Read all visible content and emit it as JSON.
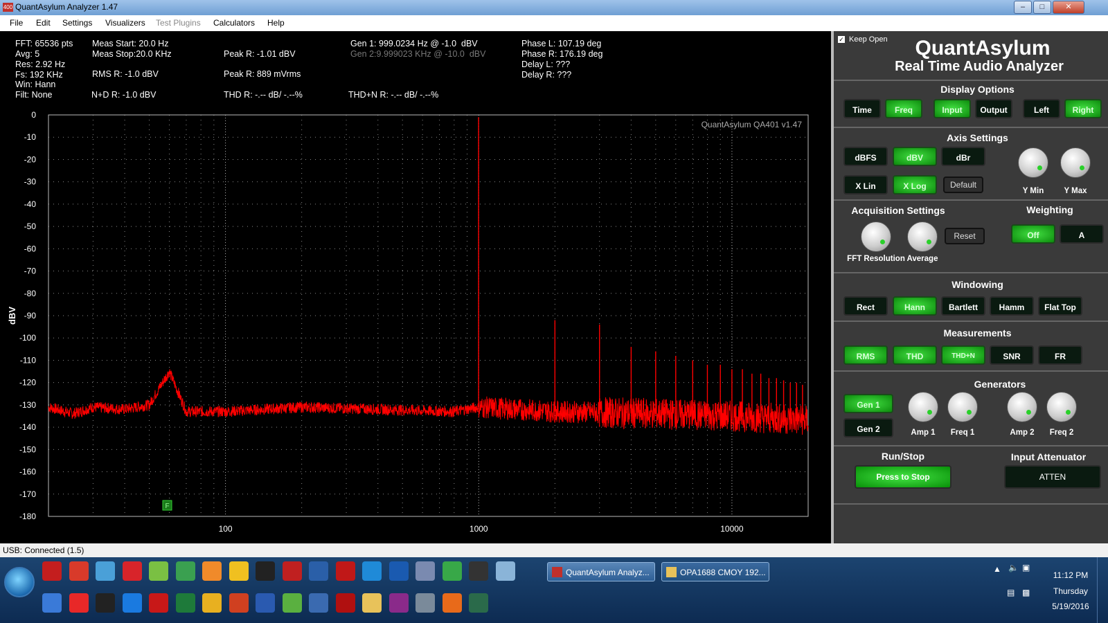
{
  "window": {
    "title": "QuantAsylum Analyzer 1.47",
    "icon_text": "400"
  },
  "menu": [
    {
      "label": "File",
      "enabled": true
    },
    {
      "label": "Edit",
      "enabled": true
    },
    {
      "label": "Settings",
      "enabled": true
    },
    {
      "label": "Visualizers",
      "enabled": true
    },
    {
      "label": "Test Plugins",
      "enabled": false
    },
    {
      "label": "Calculators",
      "enabled": true
    },
    {
      "label": "Help",
      "enabled": true
    }
  ],
  "readouts": {
    "fft": "FFT: 65536 pts",
    "avg": "Avg: 5",
    "res": "Res: 2.92 Hz",
    "fs": "Fs: 192 KHz",
    "win": "Win: Hann",
    "filt": "Filt: None",
    "meas_start": "Meas Start: 20.0 Hz",
    "meas_stop": "Meas Stop:20.0 KHz",
    "rms_r": "RMS R: -1.0 dBV",
    "nd_r": "N+D R: -1.0 dBV",
    "peak_r_dbv": "Peak R: -1.01 dBV",
    "peak_r_mv": "Peak R: 889 mVrms",
    "thd_r": "THD R: -.-- dB/ -.--%",
    "gen1": "Gen 1: 999.0234 Hz @ -1.0  dBV",
    "gen2": "Gen 2:9.999023 KHz @ -10.0  dBV",
    "thdn_r": "THD+N R: -.-- dB/ -.--%",
    "phase_l": "Phase L: 107.19 deg",
    "phase_r": "Phase R: 176.19 deg",
    "delay_l": "Delay L: ???",
    "delay_r": "Delay R: ???"
  },
  "plot": {
    "watermark": "QuantAsylum QA401 v1.47",
    "marker_label": "F",
    "trace_color": "#ff0000",
    "grid_color": "#8a8a8a"
  },
  "chart_data": {
    "type": "line",
    "title": "",
    "xlabel": "",
    "ylabel": "dBV",
    "x_scale": "log",
    "xlim": [
      20,
      20000
    ],
    "ylim": [
      -180,
      0
    ],
    "x_ticks": [
      "100",
      "1000",
      "10000"
    ],
    "y_ticks": [
      "0",
      "-10",
      "-20",
      "-30",
      "-40",
      "-50",
      "-60",
      "-70",
      "-80",
      "-90",
      "-100",
      "-110",
      "-120",
      "-130",
      "-140",
      "-150",
      "-160",
      "-170",
      "-180"
    ],
    "grid": true,
    "series": [
      {
        "color": "#ff0000",
        "baseline": [
          [
            20,
            -131
          ],
          [
            25,
            -134
          ],
          [
            30,
            -131
          ],
          [
            40,
            -132
          ],
          [
            50,
            -130
          ],
          [
            60,
            -115
          ],
          [
            70,
            -133
          ],
          [
            100,
            -133
          ],
          [
            200,
            -131
          ],
          [
            400,
            -132
          ],
          [
            800,
            -133
          ],
          [
            1000,
            -131
          ],
          [
            2000,
            -133
          ],
          [
            5000,
            -134
          ],
          [
            10000,
            -135
          ],
          [
            20000,
            -137
          ]
        ],
        "peaks": [
          [
            999,
            -1
          ],
          [
            2000,
            -92
          ],
          [
            3000,
            -94
          ],
          [
            4000,
            -104
          ],
          [
            5000,
            -106
          ],
          [
            6000,
            -108
          ],
          [
            7000,
            -110
          ],
          [
            8000,
            -112
          ],
          [
            9000,
            -112
          ],
          [
            10000,
            -114
          ],
          [
            11000,
            -114
          ],
          [
            12000,
            -116
          ],
          [
            13000,
            -116
          ],
          [
            14000,
            -118
          ],
          [
            15000,
            -118
          ],
          [
            16000,
            -119
          ],
          [
            17000,
            -120
          ],
          [
            18000,
            -120
          ],
          [
            19000,
            -121
          ]
        ]
      }
    ]
  },
  "panel": {
    "keep_open": "Keep Open",
    "brand": "QuantAsylum",
    "subtitle": "Real Time Audio Analyzer",
    "display_title": "Display Options",
    "display_buttons": [
      "Time",
      "Freq",
      "Input",
      "Output",
      "Left",
      "Right"
    ],
    "axis_title": "Axis Settings",
    "axis_buttons": [
      "dBFS",
      "dBV",
      "dBr",
      "X Lin",
      "X Log",
      "Default"
    ],
    "knob_ymin": "Y Min",
    "knob_ymax": "Y Max",
    "acq_title": "Acquisition Settings",
    "knob_fft": "FFT Resolution",
    "knob_avg": "Average",
    "reset": "Reset",
    "weight_title": "Weighting",
    "weight_buttons": [
      "Off",
      "A"
    ],
    "window_title": "Windowing",
    "window_buttons": [
      "Rect",
      "Hann",
      "Bartlett",
      "Hamm",
      "Flat Top"
    ],
    "meas_title": "Measurements",
    "meas_buttons": [
      "RMS",
      "THD",
      "THD+N",
      "SNR",
      "FR"
    ],
    "gen_title": "Generators",
    "gen_buttons": [
      "Gen 1",
      "Gen 2"
    ],
    "knob_amp1": "Amp 1",
    "knob_freq1": "Freq 1",
    "knob_amp2": "Amp 2",
    "knob_freq2": "Freq 2",
    "run_title": "Run/Stop",
    "run_button": "Press to Stop",
    "atten_title": "Input Attenuator",
    "atten_button": "ATTEN"
  },
  "status": {
    "text": "USB: Connected  (1.5)"
  },
  "taskbar": {
    "tasks": [
      "QuantAsylum Analyz...",
      "OPA1688 CMOY 192..."
    ],
    "time": "11:12 PM",
    "day": "Thursday",
    "date": "5/19/2016",
    "icons": [
      "acrobat-icon",
      "pdf-icon",
      "network-icon",
      "64-icon",
      "tool-icon",
      "app-icon",
      "pencil-icon",
      "duck-icon",
      "cmd-icon",
      "app-icon",
      "outlook-icon",
      "eagle-icon",
      "kodi-icon",
      "fc-icon",
      "doc-icon",
      "chrome-icon",
      "chip-icon",
      "calculator-icon",
      "fan-icon",
      "splat-icon",
      "kindle-icon",
      "ie-icon",
      "app-icon",
      "excel-icon",
      "mail-icon",
      "ppt-icon",
      "word-icon",
      "puzzle-icon",
      "wrench-icon",
      "record-icon",
      "folder-icon",
      "rar-icon",
      "camera-icon",
      "firefox-icon",
      "app-icon"
    ]
  }
}
